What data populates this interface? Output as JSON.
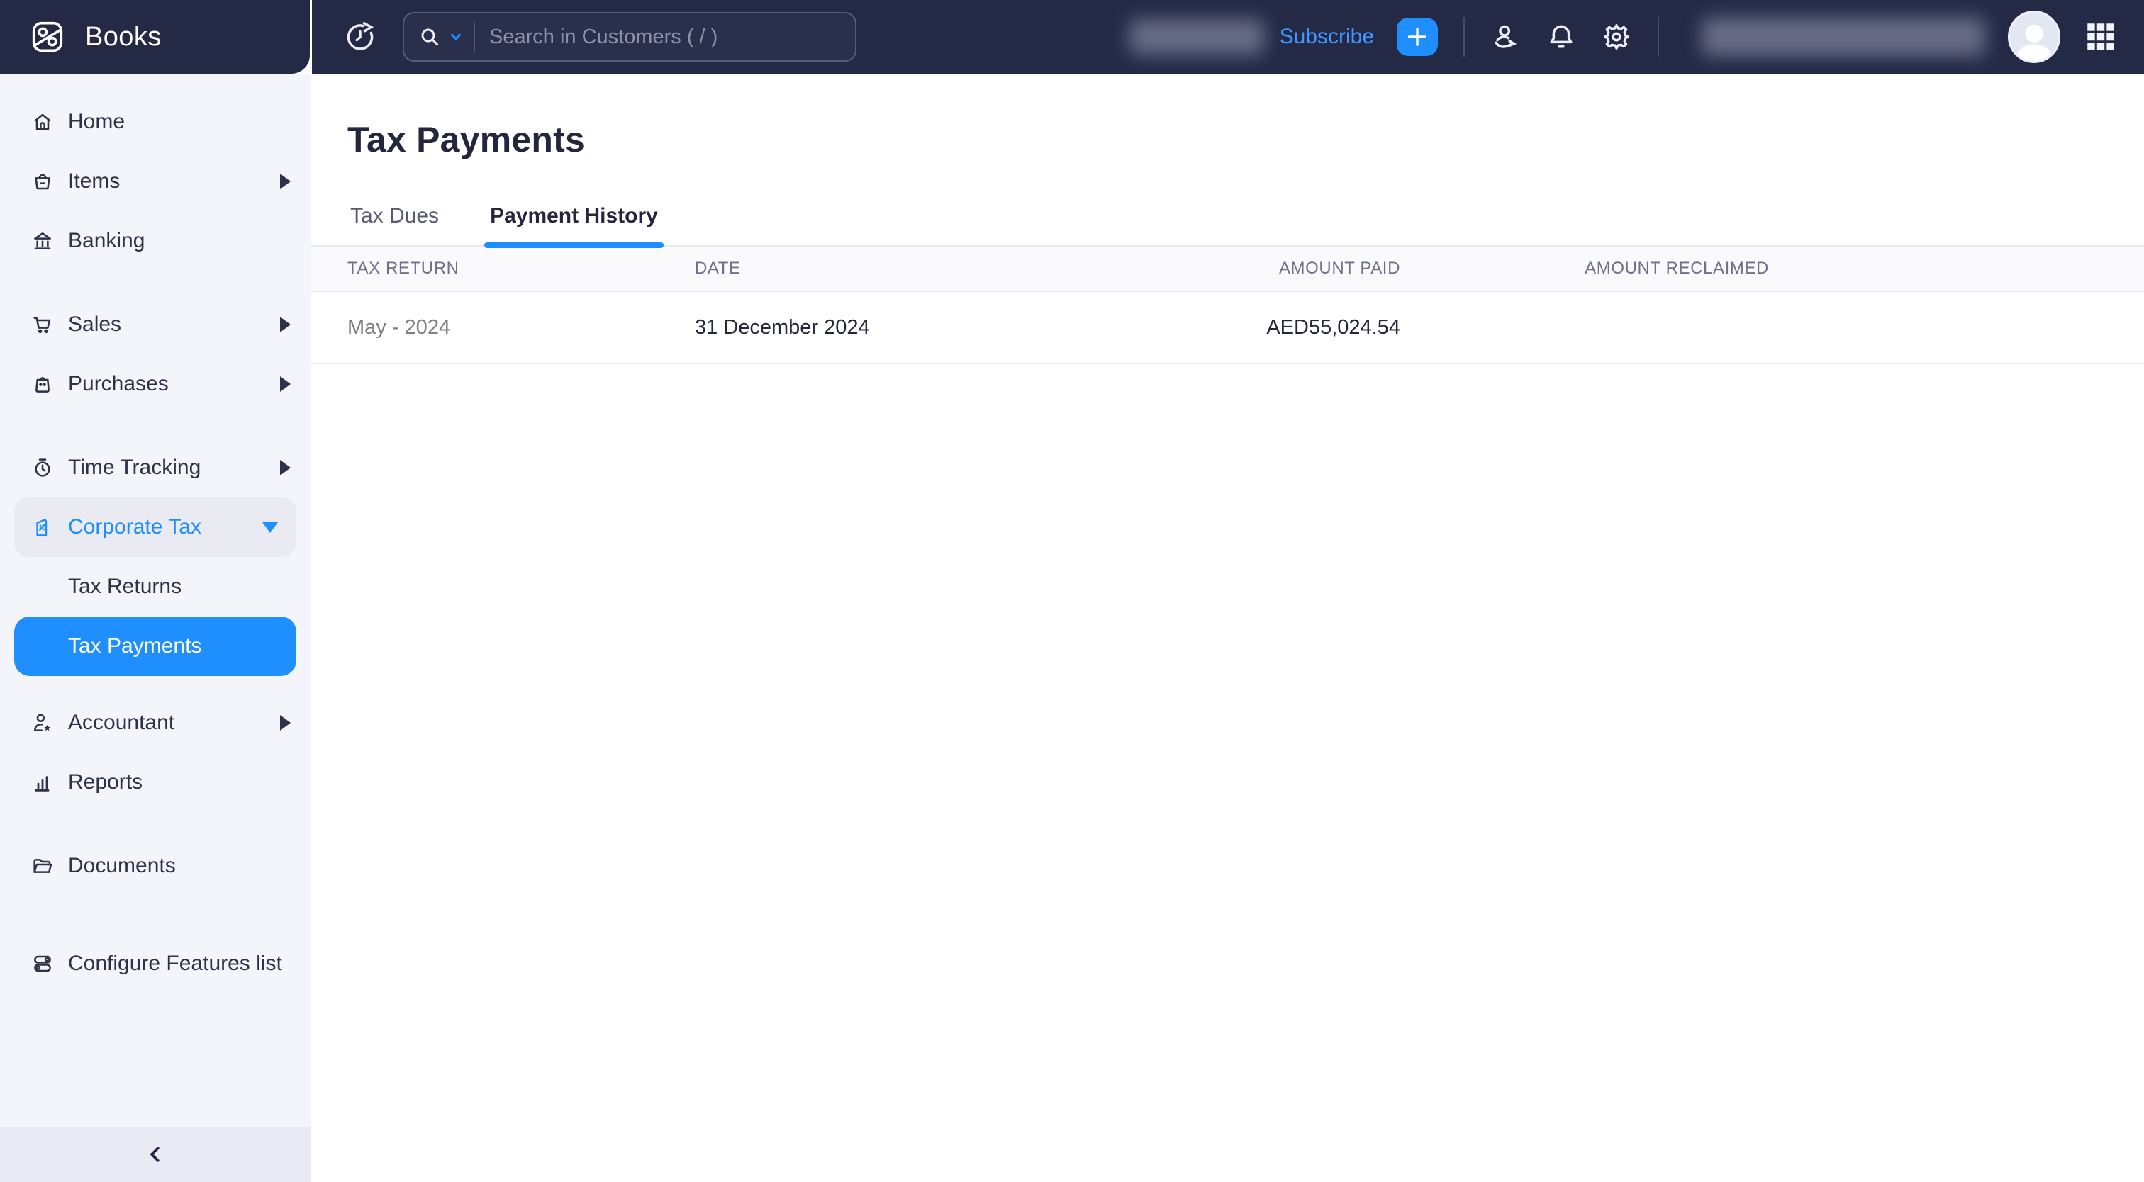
{
  "brand": {
    "name": "Books"
  },
  "topbar": {
    "search_placeholder": "Search in Customers ( / )",
    "subscribe_label": "Subscribe",
    "icons": [
      "history-icon",
      "search-icon",
      "chevron-down-icon",
      "add-icon",
      "referral-icon",
      "notifications-icon",
      "settings-icon",
      "avatar",
      "apps-grid-icon"
    ]
  },
  "sidebar": {
    "items": [
      {
        "label": "Home",
        "icon": "home-icon"
      },
      {
        "label": "Items",
        "icon": "basket-icon",
        "expandable": true
      },
      {
        "label": "Banking",
        "icon": "bank-icon"
      },
      {
        "label": "Sales",
        "icon": "cart-icon",
        "expandable": true
      },
      {
        "label": "Purchases",
        "icon": "bag-icon",
        "expandable": true
      },
      {
        "label": "Time Tracking",
        "icon": "stopwatch-icon",
        "expandable": true
      },
      {
        "label": "Corporate Tax",
        "icon": "tax-document-icon",
        "expanded": true
      },
      {
        "label": "Tax Returns",
        "sub_item": true
      },
      {
        "label": "Tax Payments",
        "sub_item": true,
        "active": true
      },
      {
        "label": "Accountant",
        "icon": "accountant-icon",
        "expandable": true
      },
      {
        "label": "Reports",
        "icon": "reports-icon"
      },
      {
        "label": "Documents",
        "icon": "folder-icon"
      },
      {
        "label": "Configure Features list",
        "icon": "features-icon"
      }
    ]
  },
  "page": {
    "title": "Tax Payments",
    "tabs": [
      {
        "label": "Tax Dues",
        "active": false
      },
      {
        "label": "Payment History",
        "active": true
      }
    ]
  },
  "table": {
    "columns": [
      "TAX RETURN",
      "DATE",
      "AMOUNT PAID",
      "AMOUNT RECLAIMED"
    ],
    "rows": [
      {
        "tax_return": "May - 2024",
        "date": "31 December 2024",
        "amount_paid": "AED55,024.54",
        "amount_reclaimed": ""
      }
    ]
  },
  "colors": {
    "accent_blue": "#1f8fff",
    "topbar_navy": "#242946",
    "sidebar_bg": "#f4f5fb",
    "collapse_bar_bg": "#e9eaf3"
  }
}
